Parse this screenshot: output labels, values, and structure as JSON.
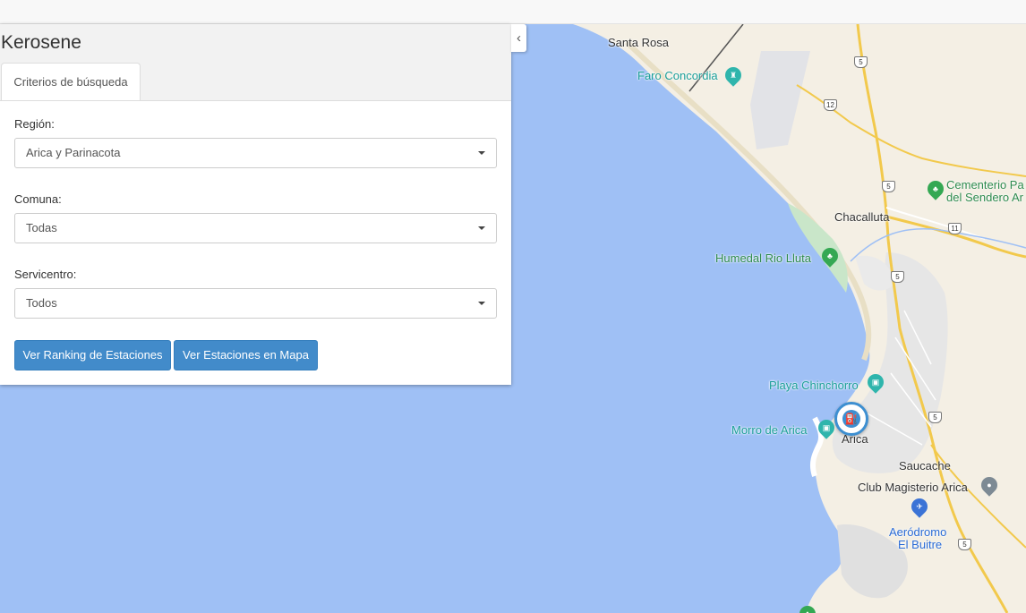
{
  "panel": {
    "title": "Kerosene",
    "collapse_icon": "chevron-left-icon",
    "tab_label": "Criterios de búsqueda",
    "fields": {
      "region": {
        "label": "Región:",
        "value": "Arica y Parinacota"
      },
      "comuna": {
        "label": "Comuna:",
        "value": "Todas"
      },
      "servicentro": {
        "label": "Servicentro:",
        "value": "Todos"
      }
    },
    "buttons": {
      "ranking": "Ver Ranking de Estaciones",
      "mapa": "Ver Estaciones en Mapa"
    },
    "button_color": "#428bca"
  },
  "map": {
    "water_color": "#9fc0f5",
    "land_color": "#f5f0e6",
    "places": {
      "santa_rosa": "Santa Rosa",
      "faro": "Faro Concordia",
      "cementerio_1": "Cementerio Pa",
      "cementerio_2": "del Sendero Ar",
      "chacalluta": "Chacalluta",
      "humedal": "Humedal Rio Lluta",
      "playa": "Playa Chinchorro",
      "morro": "Morro de Arica",
      "arica": "Arica",
      "saucache": "Saucache",
      "club": "Club Magisterio Arica",
      "aerodromo_1": "Aeródromo",
      "aerodromo_2": "El Buitre"
    },
    "routes": [
      "5",
      "12",
      "5",
      "11",
      "5",
      "5",
      "5"
    ],
    "marker_icon": "fuel-pump-icon"
  }
}
